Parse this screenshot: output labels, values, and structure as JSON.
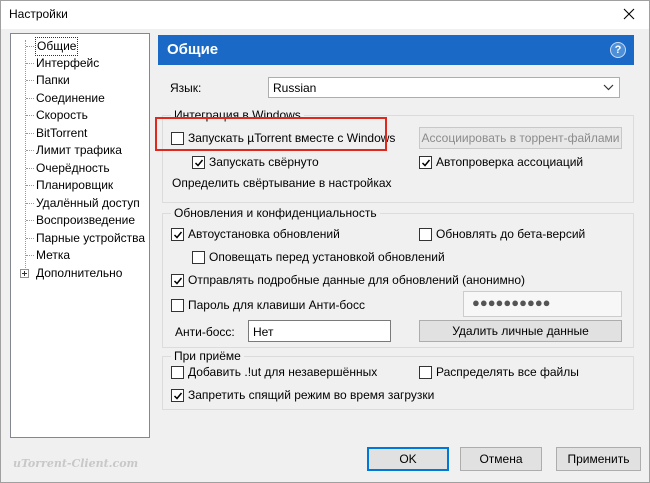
{
  "window": {
    "title": "Настройки"
  },
  "sidebar": {
    "items": [
      {
        "label": "Общие",
        "selected": true
      },
      {
        "label": "Интерфейс"
      },
      {
        "label": "Папки"
      },
      {
        "label": "Соединение"
      },
      {
        "label": "Скорость"
      },
      {
        "label": "BitTorrent"
      },
      {
        "label": "Лимит трафика"
      },
      {
        "label": "Очерёдность"
      },
      {
        "label": "Планировщик"
      },
      {
        "label": "Удалённый доступ"
      },
      {
        "label": "Воспроизведение"
      },
      {
        "label": "Парные устройства"
      },
      {
        "label": "Метка"
      },
      {
        "label": "Дополнительно",
        "expandable": true
      }
    ]
  },
  "header": {
    "title": "Общие",
    "help": "?"
  },
  "language": {
    "label": "Язык:",
    "value": "Russian"
  },
  "integration": {
    "title": "Интеграция в Windows",
    "start_with_windows": {
      "label": "Запускать µTorrent вместе с Windows",
      "checked": false
    },
    "associate_button": "Ассоциировать в торрент-файлами",
    "start_minimized": {
      "label": "Запускать свёрнуто",
      "checked": true
    },
    "auto_check_assoc": {
      "label": "Автопроверка ассоциаций",
      "checked": true
    },
    "minimize_setting_text": "Определить свёртывание в настройках"
  },
  "updates": {
    "title": "Обновления и конфиденциальность",
    "auto_install": {
      "label": "Автоустановка обновлений",
      "checked": true
    },
    "beta": {
      "label": "Обновлять до бета-версий",
      "checked": false
    },
    "notify_before": {
      "label": "Оповещать перед установкой обновлений",
      "checked": false
    },
    "send_data": {
      "label": "Отправлять подробные данные для обновлений (анонимно)",
      "checked": true
    },
    "boss_password": {
      "label": "Пароль для клавиши Анти-босс",
      "checked": false
    },
    "boss_password_value": "●●●●●●●●●●",
    "boss_key_label": "Анти-босс:",
    "boss_key_value": "Нет",
    "delete_private_button": "Удалить личные данные"
  },
  "on_download": {
    "title": "При приёме",
    "add_ut": {
      "label": "Добавить .!ut для незавершённых",
      "checked": false
    },
    "preallocate": {
      "label": "Распределять все файлы",
      "checked": false
    },
    "prevent_sleep": {
      "label": "Запретить спящий режим во время загрузки",
      "checked": true
    }
  },
  "footer": {
    "ok": "OK",
    "cancel": "Отмена",
    "apply": "Применить"
  },
  "watermark": "uTorrent-Client.com",
  "colors": {
    "header": "#1a69c6",
    "highlight": "#e0281e",
    "primary_border": "#0078d7"
  }
}
